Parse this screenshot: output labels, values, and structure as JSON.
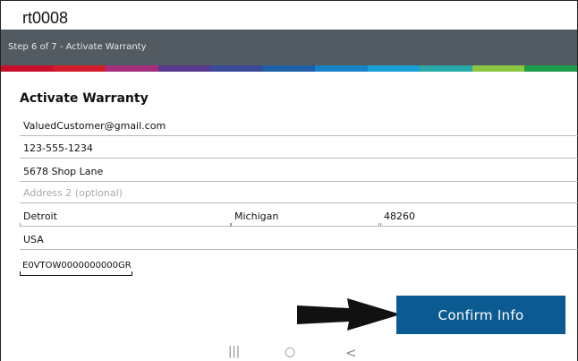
{
  "app": {
    "title": "rt0008"
  },
  "step": {
    "label": "Step 6 of 7 - Activate Warranty"
  },
  "strip_colors": [
    "#c8102e",
    "#d31b2c",
    "#a42d7c",
    "#56398f",
    "#3a4a9a",
    "#1d5fa8",
    "#1483c8",
    "#18a0d6",
    "#29aaa8",
    "#8cc63f",
    "#1d9a4a"
  ],
  "form": {
    "title": "Activate Warranty",
    "email": "ValuedCustomer@gmail.com",
    "phone": "123-555-1234",
    "address1": "5678 Shop Lane",
    "address2_placeholder": "Address 2 (optional)",
    "city": "Detroit",
    "state": "Michigan",
    "zip": "48260",
    "country": "USA",
    "serial": "E0VTOW0000000000GR"
  },
  "actions": {
    "confirm_label": "Confirm Info"
  },
  "android_nav": {
    "recents": "|||",
    "home": "○",
    "back": "<"
  }
}
